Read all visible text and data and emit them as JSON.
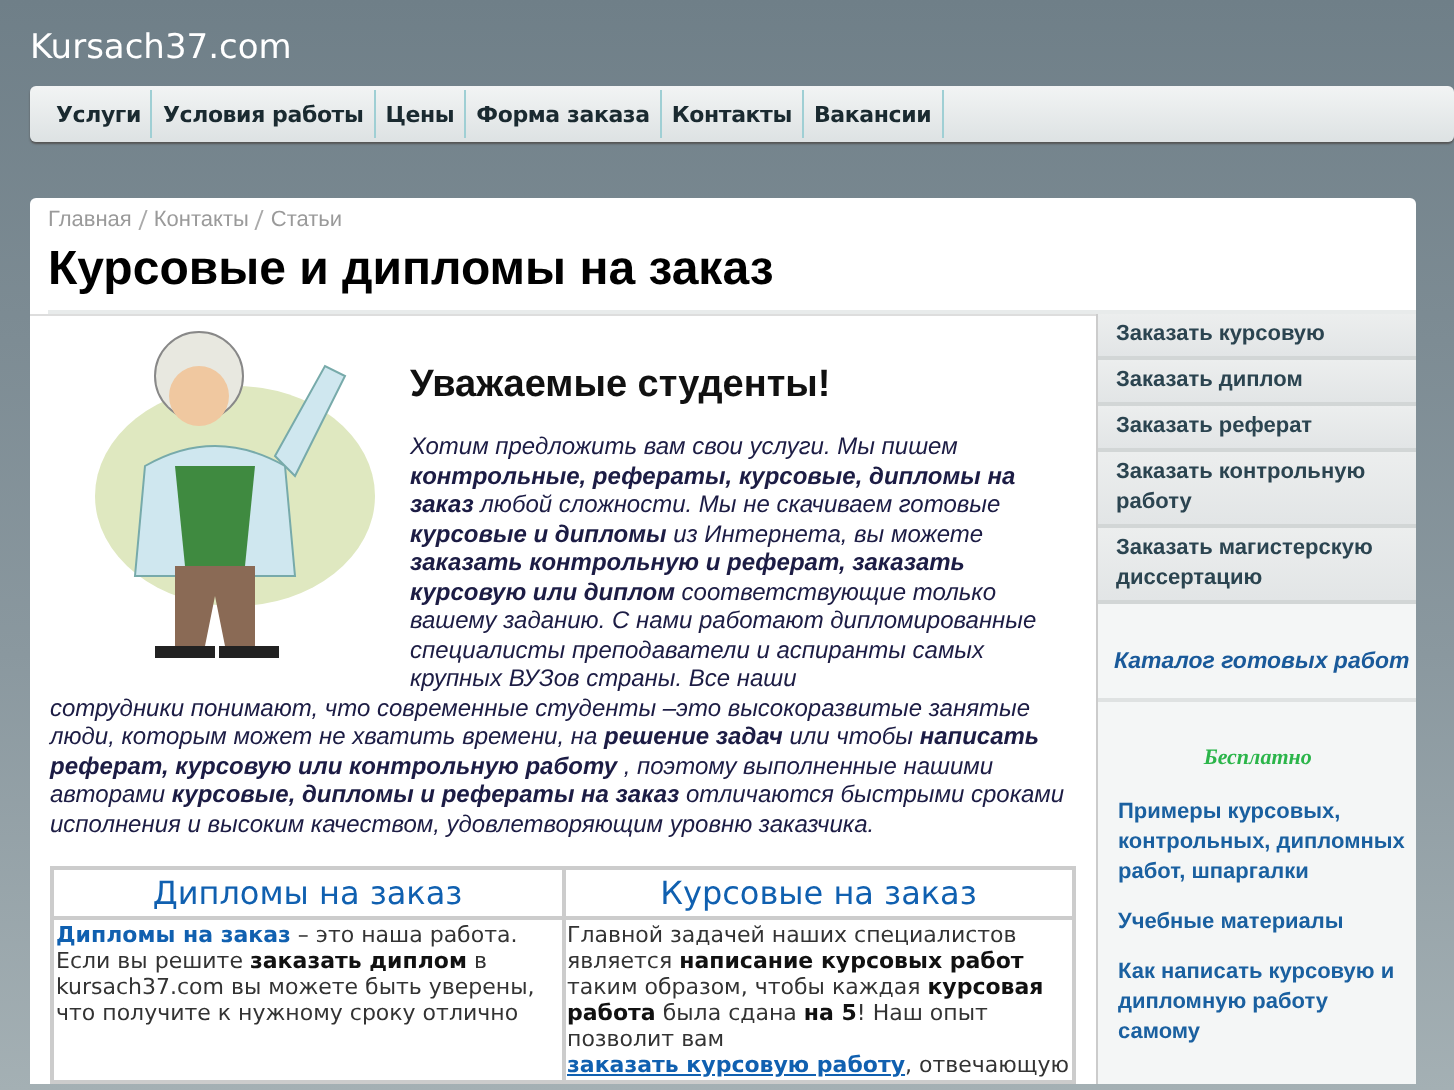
{
  "site_title": "Kursach37.com",
  "nav": [
    "Услуги",
    "Условия работы",
    "Цены",
    "Форма заказа",
    "Контакты",
    "Вакансии"
  ],
  "breadcrumb": [
    "Главная",
    "Контакты",
    "Статьи"
  ],
  "page_title": "Курсовые и дипломы на заказ",
  "intro": {
    "heading": "Уважаемые студенты!",
    "text_beside_image": "Хотим предложить вам свои услуги. Мы пишем **контрольные, рефераты, курсовые, дипломы на заказ** любой сложности. Мы не скачиваем готовые **курсовые и дипломы** из Интернета, вы можете **заказать контрольную и реферат, заказать курсовую или диплом** соответствующие только вашему заданию. С нами работают дипломированные специалисты преподаватели и аспиранты самых крупных ВУЗов страны. Все наши",
    "text_below_image": "сотрудники понимают, что современные студенты –это высокоразвитые занятые люди, которым может не хватить времени, на **решение задач** или чтобы **написать реферат, курсовую или контрольную работу** , поэтому выполненные нашими авторами **курсовые, дипломы и рефераты на заказ** отличаются быстрыми сроками исполнения и высоким качеством, удовлетворяющим уровню заказчика."
  },
  "table": {
    "columns": [
      "Дипломы на заказ",
      "Курсовые на заказ"
    ],
    "cells": [
      [
        {
          "kind": "link",
          "text": "Дипломы на заказ"
        },
        {
          "kind": "text",
          "text": " – это наша работа. Если вы решите **заказать диплом** в kursach37.com вы можете быть уверены, что получите к нужному сроку отлично"
        }
      ],
      [
        {
          "kind": "text",
          "text": "Главной задачей наших специалистов является **написание курсовых работ** таким образом, чтобы каждая **курсовая работа** была сдана **на 5**! Наш опыт позволит вам "
        },
        {
          "kind": "link",
          "text": "заказать курсовую работу"
        },
        {
          "kind": "text",
          "text": ", отвечающую"
        }
      ]
    ]
  },
  "sidebar": {
    "menu": [
      "Заказать курсовую",
      "Заказать диплом",
      "Заказать реферат",
      "Заказать контрольную работу",
      "Заказать магистерскую диссертацию"
    ],
    "catalog": "Каталог готовых работ",
    "free_label": "Бесплатно",
    "links": [
      "Примеры курсовых, контрольных, дипломных работ, шпаргалки",
      "Учебные материалы",
      "Как написать курсовую и дипломную работу самому"
    ]
  }
}
